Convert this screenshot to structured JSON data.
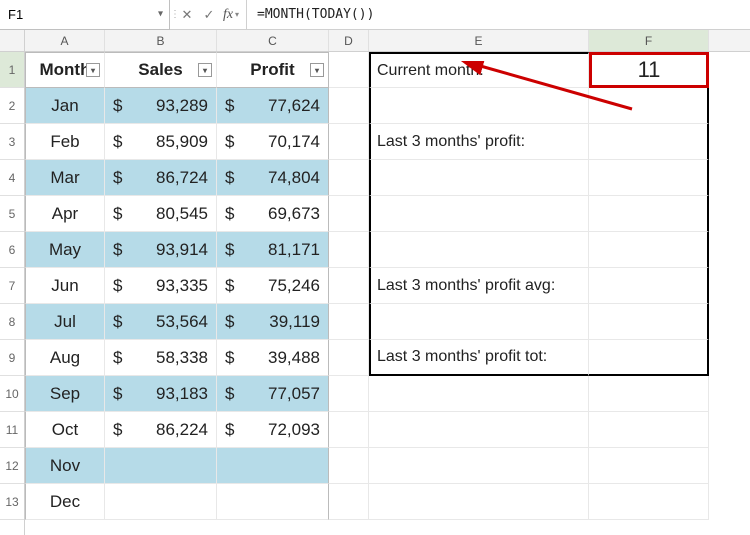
{
  "name_box": "F1",
  "formula": "=MONTH(TODAY())",
  "columns": [
    "A",
    "B",
    "C",
    "D",
    "E",
    "F"
  ],
  "rows": [
    "1",
    "2",
    "3",
    "4",
    "5",
    "6",
    "7",
    "8",
    "9",
    "10",
    "11",
    "12",
    "13"
  ],
  "table": {
    "headers": {
      "month": "Month",
      "sales": "Sales",
      "profit": "Profit"
    },
    "data": [
      {
        "month": "Jan",
        "sales": "93,289",
        "profit": "77,624"
      },
      {
        "month": "Feb",
        "sales": "85,909",
        "profit": "70,174"
      },
      {
        "month": "Mar",
        "sales": "86,724",
        "profit": "74,804"
      },
      {
        "month": "Apr",
        "sales": "80,545",
        "profit": "69,673"
      },
      {
        "month": "May",
        "sales": "93,914",
        "profit": "81,171"
      },
      {
        "month": "Jun",
        "sales": "93,335",
        "profit": "75,246"
      },
      {
        "month": "Jul",
        "sales": "53,564",
        "profit": "39,119"
      },
      {
        "month": "Aug",
        "sales": "58,338",
        "profit": "39,488"
      },
      {
        "month": "Sep",
        "sales": "93,183",
        "profit": "77,057"
      },
      {
        "month": "Oct",
        "sales": "86,224",
        "profit": "72,093"
      },
      {
        "month": "Nov",
        "sales": "",
        "profit": ""
      },
      {
        "month": "Dec",
        "sales": "",
        "profit": ""
      }
    ]
  },
  "side": {
    "e1": "Current month:",
    "e3": "Last 3 months' profit:",
    "e7": "Last 3 months' profit avg:",
    "e9": "Last 3 months' profit tot:",
    "f1": "11"
  },
  "currency": "$"
}
